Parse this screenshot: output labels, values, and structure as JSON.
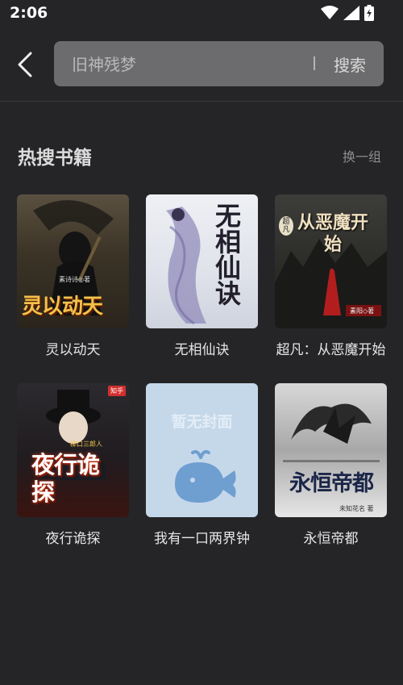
{
  "status": {
    "time": "2:06"
  },
  "search": {
    "placeholder": "旧神残梦",
    "button_label": "搜索"
  },
  "section": {
    "title": "热搜书籍",
    "refresh_label": "换一组"
  },
  "books": [
    {
      "title": "灵以动天",
      "cover_text": "灵以动天",
      "author_tag": "素诗诗◎著"
    },
    {
      "title": "无相仙诀",
      "cover_text": "无相仙诀"
    },
    {
      "title": "超凡：从恶魔开始",
      "cover_text": "从恶魔开始",
      "badge": "超凡",
      "author_tag": "素阳◇著"
    },
    {
      "title": "夜行诡探",
      "cover_text": "夜行诡探",
      "badge": "知乎",
      "sub": "柳口三郎人"
    },
    {
      "title": "我有一口两界钟",
      "cover_text": "暂无封面"
    },
    {
      "title": "永恒帝都",
      "cover_text": "永恒帝都",
      "author_tag": "未知花名 著"
    }
  ]
}
